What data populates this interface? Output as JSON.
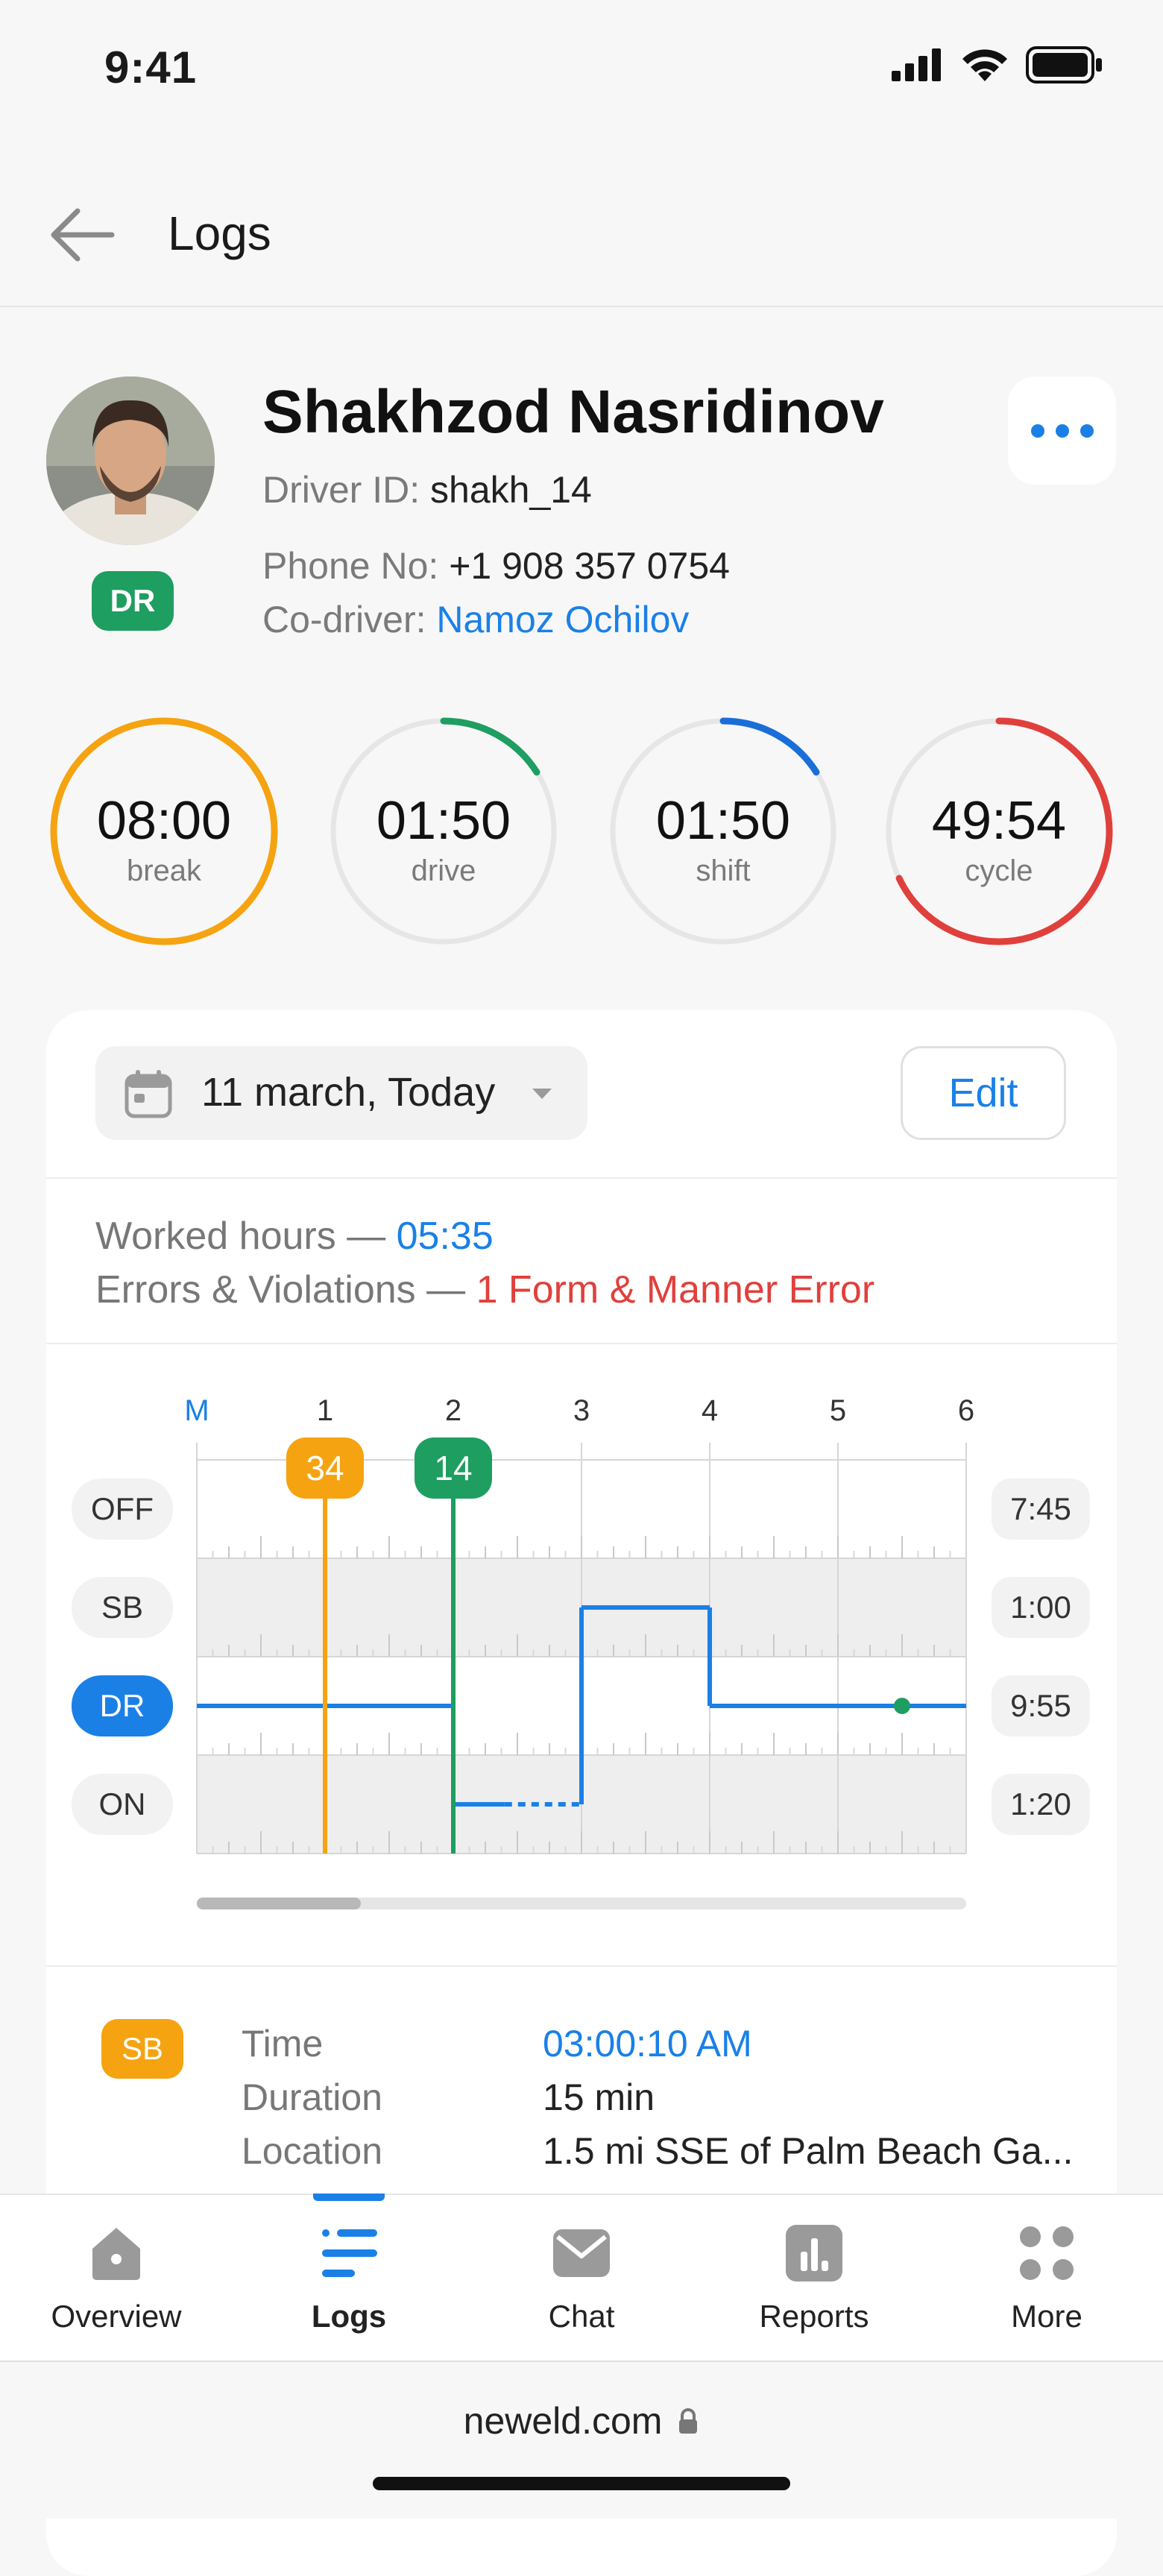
{
  "status_bar": {
    "time": "9:41"
  },
  "header": {
    "title": "Logs"
  },
  "driver": {
    "name": "Shakhzod Nasridinov",
    "status_badge": "DR",
    "id_label": "Driver ID:",
    "id_value": "shakh_14",
    "phone_label": "Phone No:",
    "phone_value": "+1 908 357 0754",
    "codriver_label": "Co-driver:",
    "codriver_value": "Namoz Ochilov"
  },
  "gauges": [
    {
      "value": "08:00",
      "label": "break",
      "color": "#f5a310",
      "progress": 1.0
    },
    {
      "value": "01:50",
      "label": "drive",
      "color": "#1e9e60",
      "progress": 0.16
    },
    {
      "value": "01:50",
      "label": "shift",
      "color": "#1a6ed8",
      "progress": 0.16
    },
    {
      "value": "49:54",
      "label": "cycle",
      "color": "#e0403c",
      "progress": 0.68
    }
  ],
  "log": {
    "date": "11 march, Today",
    "edit_label": "Edit",
    "worked_label": "Worked hours —",
    "worked_value": "05:35",
    "errors_label": "Errors & Violations —",
    "errors_value": "1 Form & Manner Error"
  },
  "chart_data": {
    "type": "line",
    "hour_labels": [
      "M",
      "1",
      "2",
      "3",
      "4",
      "5",
      "6"
    ],
    "rows": [
      {
        "label": "OFF",
        "total": "7:45"
      },
      {
        "label": "SB",
        "total": "1:00"
      },
      {
        "label": "DR",
        "total": "9:55",
        "active": true
      },
      {
        "label": "ON",
        "total": "1:20"
      }
    ],
    "markers": [
      {
        "text": "34",
        "hour": 1.0,
        "color": "#f5a310"
      },
      {
        "text": "14",
        "hour": 2.0,
        "color": "#1e9e60"
      }
    ],
    "status_line": [
      {
        "from": 0.0,
        "to": 2.0,
        "status": "DR"
      },
      {
        "from": 2.0,
        "to": 2.4,
        "status": "ON"
      },
      {
        "from": 2.4,
        "to": 3.0,
        "status": "ON",
        "dotted": true
      },
      {
        "from": 3.0,
        "to": 4.0,
        "status": "SB"
      },
      {
        "from": 4.0,
        "to": 6.0,
        "status": "DR"
      }
    ],
    "current_point": {
      "hour": 5.5,
      "status": "DR"
    },
    "xlim": [
      0,
      6
    ]
  },
  "event": {
    "badge": "SB",
    "time_label": "Time",
    "time_value": "03:00:10 AM",
    "duration_label": "Duration",
    "duration_value": "15 min",
    "location_label": "Location",
    "location_value": "1.5 mi SSE of Palm Beach Ga..."
  },
  "nav": [
    {
      "label": "Overview",
      "icon": "home-icon"
    },
    {
      "label": "Logs",
      "icon": "logs-icon",
      "active": true
    },
    {
      "label": "Chat",
      "icon": "chat-icon"
    },
    {
      "label": "Reports",
      "icon": "reports-icon"
    },
    {
      "label": "More",
      "icon": "grid-icon"
    }
  ],
  "browser": {
    "url": "neweld.com"
  }
}
